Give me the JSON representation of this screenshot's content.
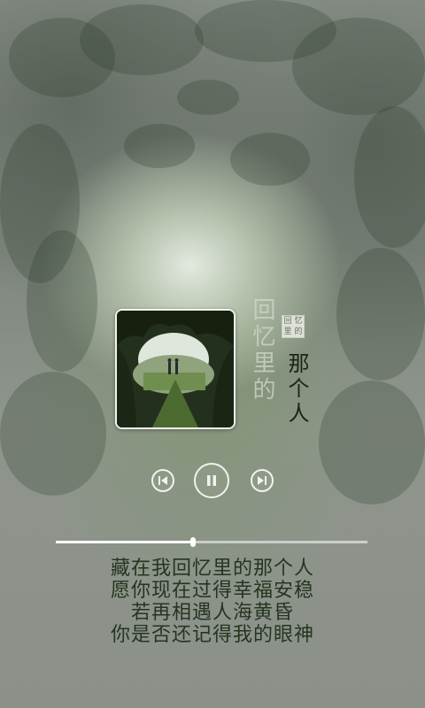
{
  "player": {
    "title_line1": "回忆里的",
    "title_line2": "那个人",
    "seal_chars": [
      "回",
      "忆",
      "里",
      "的"
    ],
    "progress_fraction": 0.44
  },
  "controls": {
    "prev_icon": "skip-previous-icon",
    "play_icon": "pause-icon",
    "next_icon": "skip-next-icon"
  },
  "lyrics": [
    "藏在我回忆里的那个人",
    "愿你现在过得幸福安稳",
    "若再相遇人海黄昏",
    "你是否还记得我的眼神"
  ],
  "colors": {
    "background": "#8a9088",
    "lyrics_text": "#25351f",
    "controls": "#f2f2ee"
  }
}
